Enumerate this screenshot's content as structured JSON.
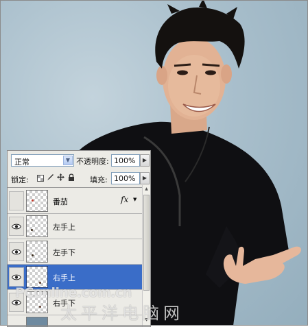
{
  "layers_panel": {
    "blend_mode": "正常",
    "opacity_label": "不透明度:",
    "opacity_value": "100%",
    "lock_label": "锁定:",
    "fill_label": "填充:",
    "fill_value": "100%",
    "layers": [
      {
        "name": "番茄",
        "visible": false,
        "selected": false,
        "has_fx": true,
        "fx_label": "fx"
      },
      {
        "name": "左手上",
        "visible": true,
        "selected": false
      },
      {
        "name": "左手下",
        "visible": true,
        "selected": false
      },
      {
        "name": "右手上",
        "visible": true,
        "selected": true
      },
      {
        "name": "右手下",
        "visible": true,
        "selected": false
      }
    ]
  },
  "watermark": {
    "text": "PConline.com.cn",
    "text_cn": "太平洋电脑网"
  },
  "colors": {
    "panel_bg": "#ecebe6",
    "selection": "#3a6dc8",
    "photo_bg": "#a9bfcc"
  }
}
